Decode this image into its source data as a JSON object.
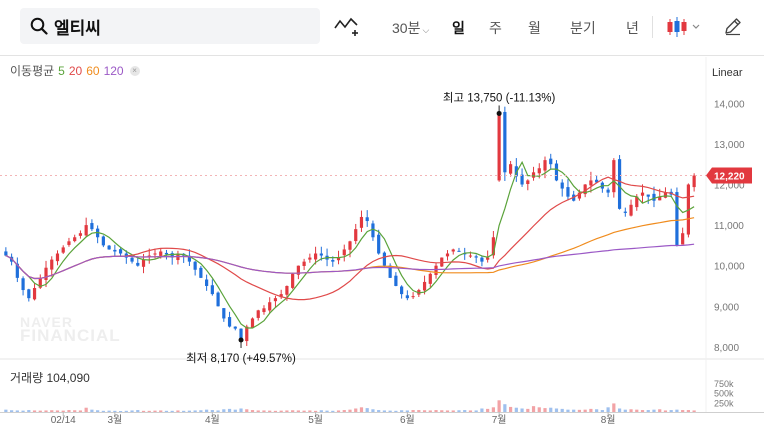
{
  "search": {
    "stock_name": "엘티씨"
  },
  "toolbar": {
    "periods": [
      {
        "label": "30분",
        "has_caret": true,
        "active": false
      },
      {
        "label": "일",
        "has_caret": false,
        "active": true
      },
      {
        "label": "주",
        "has_caret": false,
        "active": false
      },
      {
        "label": "월",
        "has_caret": false,
        "active": false
      },
      {
        "label": "분기",
        "has_caret": false,
        "active": false
      },
      {
        "label": "년",
        "has_caret": false,
        "active": false
      }
    ],
    "icons": [
      "chart-draw-icon",
      "candle-type-icon",
      "pencil-icon"
    ]
  },
  "legend": {
    "ma_title": "이동평균",
    "ma_items": [
      {
        "label": "5",
        "color": "#5aa33a"
      },
      {
        "label": "20",
        "color": "#e04a4a"
      },
      {
        "label": "60",
        "color": "#f08c1e"
      },
      {
        "label": "120",
        "color": "#9b59c6"
      }
    ],
    "scale_mode": "Linear",
    "volume_label": "거래량 104,090"
  },
  "watermark": {
    "line1": "NAVER",
    "line2": "FINANCIAL"
  },
  "colors": {
    "up": "#e2383f",
    "down": "#1f6fdb",
    "current_price_bg": "#e2383f"
  },
  "chart_data": {
    "type": "candlestick",
    "y_axis": {
      "min": 7800,
      "max": 14500,
      "ticks": [
        "14,000",
        "13,000",
        "12,000",
        "11,000",
        "10,000",
        "9,000",
        "8,000"
      ],
      "tick_values": [
        14000,
        13000,
        12000,
        11000,
        10000,
        9000,
        8000
      ]
    },
    "current_price": {
      "value": 12220,
      "label": "12,220"
    },
    "annotations": {
      "high": {
        "value": 13750,
        "label": "최고 13,750 (-11.13%)",
        "index": 86
      },
      "low": {
        "value": 8170,
        "label": "최저 8,170 (+49.57%)",
        "index": 41
      }
    },
    "x_labels": [
      {
        "label": "02/14",
        "index": 10
      },
      {
        "label": "3월",
        "index": 19
      },
      {
        "label": "4월",
        "index": 36
      },
      {
        "label": "5월",
        "index": 54
      },
      {
        "label": "6월",
        "index": 70
      },
      {
        "label": "7월",
        "index": 86
      },
      {
        "label": "8월",
        "index": 105
      }
    ],
    "volume_axis": {
      "max": 1000,
      "ticks": [
        "750k",
        "500k",
        "250k"
      ],
      "tick_values": [
        750,
        500,
        250
      ]
    },
    "close": [
      10250,
      10100,
      9700,
      9400,
      9200,
      9450,
      9700,
      9950,
      10150,
      10300,
      10450,
      10600,
      10700,
      10800,
      11000,
      10900,
      10700,
      10500,
      10400,
      10350,
      10300,
      10200,
      10100,
      10000,
      10150,
      10250,
      10300,
      10350,
      10280,
      10200,
      10300,
      10250,
      10100,
      9900,
      9700,
      9500,
      9300,
      9000,
      8700,
      8500,
      8450,
      8170,
      8500,
      8700,
      8900,
      8950,
      9100,
      9200,
      9300,
      9500,
      9800,
      10000,
      10100,
      10200,
      10300,
      10250,
      10150,
      10100,
      10200,
      10400,
      10600,
      10900,
      11200,
      11100,
      10700,
      10300,
      10000,
      9700,
      9500,
      9300,
      9200,
      9250,
      9400,
      9600,
      9800,
      10000,
      10200,
      10300,
      10400,
      10350,
      10300,
      10250,
      10200,
      10100,
      10200,
      10700,
      13750,
      12300,
      12500,
      12200,
      12000,
      12100,
      12300,
      12400,
      12600,
      12500,
      12100,
      11900,
      11700,
      11600,
      11800,
      12000,
      12100,
      12050,
      11900,
      11800,
      12600,
      11400,
      11300,
      11500,
      11700,
      11800,
      11700,
      11600,
      11700,
      11800,
      11750,
      10500,
      10800,
      12000,
      12220
    ],
    "volume_k": [
      60,
      45,
      40,
      35,
      50,
      40,
      35,
      40,
      45,
      40,
      35,
      50,
      45,
      40,
      110,
      60,
      45,
      30,
      35,
      30,
      25,
      30,
      40,
      50,
      30,
      30,
      35,
      40,
      30,
      30,
      40,
      30,
      35,
      40,
      45,
      60,
      50,
      40,
      70,
      80,
      60,
      90,
      70,
      50,
      40,
      40,
      35,
      30,
      35,
      40,
      45,
      40,
      35,
      40,
      30,
      45,
      35,
      30,
      40,
      50,
      60,
      90,
      120,
      100,
      70,
      50,
      40,
      35,
      30,
      45,
      40,
      50,
      50,
      45,
      40,
      50,
      45,
      40,
      40,
      45,
      50,
      40,
      40,
      90,
      80,
      120,
      300,
      200,
      130,
      110,
      90,
      80,
      150,
      120,
      100,
      110,
      90,
      80,
      60,
      60,
      55,
      60,
      80,
      70,
      50,
      120,
      220,
      90,
      60,
      70,
      60,
      50,
      50,
      60,
      70,
      40,
      50,
      60,
      50,
      50,
      40
    ]
  }
}
